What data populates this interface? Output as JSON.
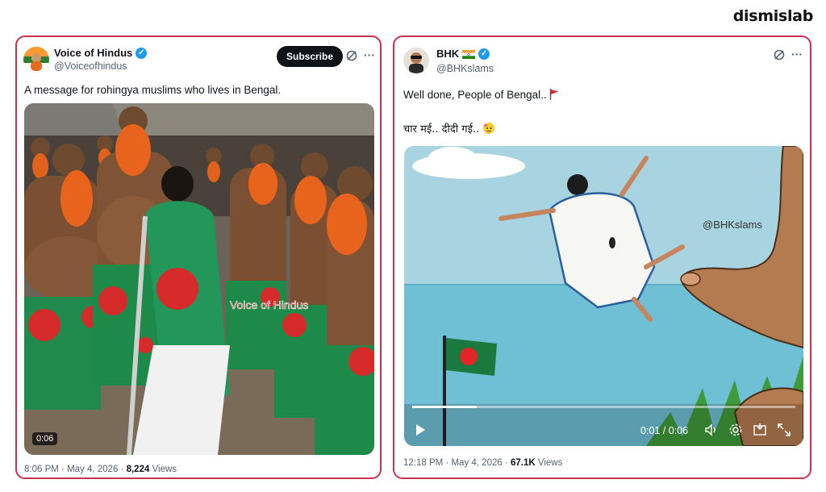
{
  "brand": "dismislab",
  "left_post": {
    "author_name": "Voice of Hindus",
    "handle": "@Voiceofhindus",
    "subscribe_label": "Subscribe",
    "text": "A message for rohingya muslims who lives in Bengal.",
    "video_watermark": "Voice of Hindus",
    "video_duration": "0:06",
    "time": "8:06 PM",
    "date": "May 4, 2026",
    "views_count": "8,224",
    "views_label": "Views"
  },
  "right_post": {
    "author_name": "BHK",
    "handle": "@BHKslams",
    "text_line1": "Well done, People of Bengal..",
    "text_line2": "चार मई.. दीदी गई..",
    "video_watermark": "@BHKslams",
    "video_time": "0:01 / 0:06",
    "time": "12:18 PM",
    "date": "May 4, 2026",
    "views_count": "67.1K",
    "views_label": "Views"
  }
}
